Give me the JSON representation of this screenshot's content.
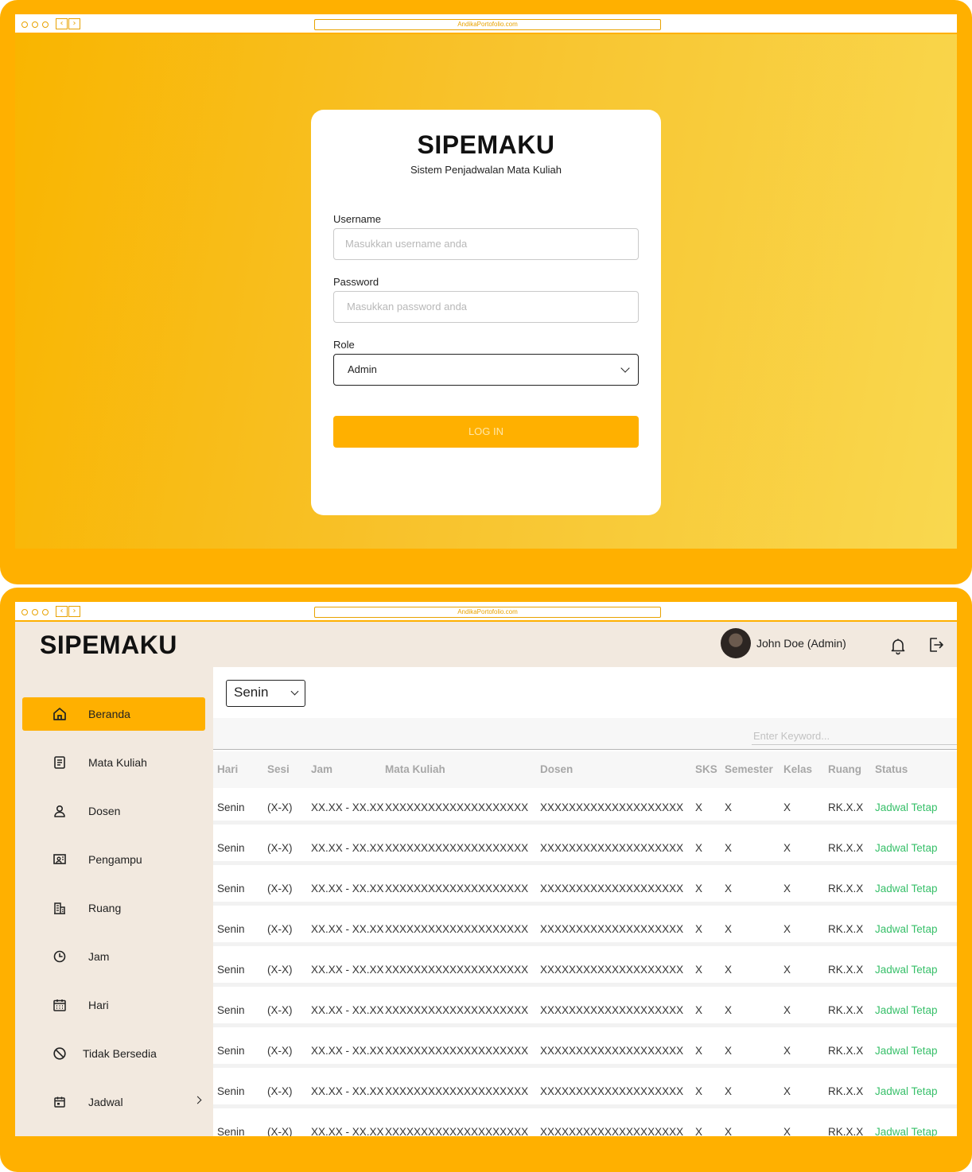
{
  "browser": {
    "url": "AndikaPortofolio.com"
  },
  "login": {
    "title": "SIPEMAKU",
    "subtitle": "Sistem Penjadwalan Mata Kuliah",
    "username_label": "Username",
    "username_placeholder": "Masukkan username anda",
    "password_label": "Password",
    "password_placeholder": "Masukkan password anda",
    "role_label": "Role",
    "role_value": "Admin",
    "button": "LOG IN"
  },
  "dashboard": {
    "brand": "SIPEMAKU",
    "user": "John Doe (Admin)",
    "sidebar": [
      {
        "label": "Beranda",
        "icon": "home-icon",
        "active": true
      },
      {
        "label": "Mata Kuliah",
        "icon": "document-icon"
      },
      {
        "label": "Dosen",
        "icon": "user-icon"
      },
      {
        "label": "Pengampu",
        "icon": "presentation-icon"
      },
      {
        "label": "Ruang",
        "icon": "building-icon"
      },
      {
        "label": "Jam",
        "icon": "clock-icon"
      },
      {
        "label": "Hari",
        "icon": "calendar-icon"
      },
      {
        "label": "Tidak Bersedia",
        "icon": "ban-icon"
      },
      {
        "label": "Jadwal",
        "icon": "schedule-icon",
        "has_submenu": true
      }
    ],
    "day_filter": "Senin",
    "search_placeholder": "Enter Keyword...",
    "columns": [
      "Hari",
      "Sesi",
      "Jam",
      "Mata Kuliah",
      "Dosen",
      "SKS",
      "Semester",
      "Kelas",
      "Ruang",
      "Status"
    ],
    "rows": [
      [
        "Senin",
        "(X-X)",
        "XX.XX - XX.XX",
        "XXXXXXXXXXXXXXXXXXXX",
        "XXXXXXXXXXXXXXXXXXXX",
        "X",
        "X",
        "X",
        "RK.X.X",
        "Jadwal Tetap"
      ],
      [
        "Senin",
        "(X-X)",
        "XX.XX - XX.XX",
        "XXXXXXXXXXXXXXXXXXXX",
        "XXXXXXXXXXXXXXXXXXXX",
        "X",
        "X",
        "X",
        "RK.X.X",
        "Jadwal Tetap"
      ],
      [
        "Senin",
        "(X-X)",
        "XX.XX - XX.XX",
        "XXXXXXXXXXXXXXXXXXXX",
        "XXXXXXXXXXXXXXXXXXXX",
        "X",
        "X",
        "X",
        "RK.X.X",
        "Jadwal Tetap"
      ],
      [
        "Senin",
        "(X-X)",
        "XX.XX - XX.XX",
        "XXXXXXXXXXXXXXXXXXXX",
        "XXXXXXXXXXXXXXXXXXXX",
        "X",
        "X",
        "X",
        "RK.X.X",
        "Jadwal Tetap"
      ],
      [
        "Senin",
        "(X-X)",
        "XX.XX - XX.XX",
        "XXXXXXXXXXXXXXXXXXXX",
        "XXXXXXXXXXXXXXXXXXXX",
        "X",
        "X",
        "X",
        "RK.X.X",
        "Jadwal Tetap"
      ],
      [
        "Senin",
        "(X-X)",
        "XX.XX - XX.XX",
        "XXXXXXXXXXXXXXXXXXXX",
        "XXXXXXXXXXXXXXXXXXXX",
        "X",
        "X",
        "X",
        "RK.X.X",
        "Jadwal Tetap"
      ],
      [
        "Senin",
        "(X-X)",
        "XX.XX - XX.XX",
        "XXXXXXXXXXXXXXXXXXXX",
        "XXXXXXXXXXXXXXXXXXXX",
        "X",
        "X",
        "X",
        "RK.X.X",
        "Jadwal Tetap"
      ],
      [
        "Senin",
        "(X-X)",
        "XX.XX - XX.XX",
        "XXXXXXXXXXXXXXXXXXXX",
        "XXXXXXXXXXXXXXXXXXXX",
        "X",
        "X",
        "X",
        "RK.X.X",
        "Jadwal Tetap"
      ],
      [
        "Senin",
        "(X-X)",
        "XX.XX - XX.XX",
        "XXXXXXXXXXXXXXXXXXXX",
        "XXXXXXXXXXXXXXXXXXXX",
        "X",
        "X",
        "X",
        "RK.X.X",
        "Jadwal Tetap"
      ]
    ]
  },
  "colors": {
    "accent": "#FFB000",
    "sidebar_bg": "#F2E9DF",
    "status_green": "#38C06A"
  }
}
